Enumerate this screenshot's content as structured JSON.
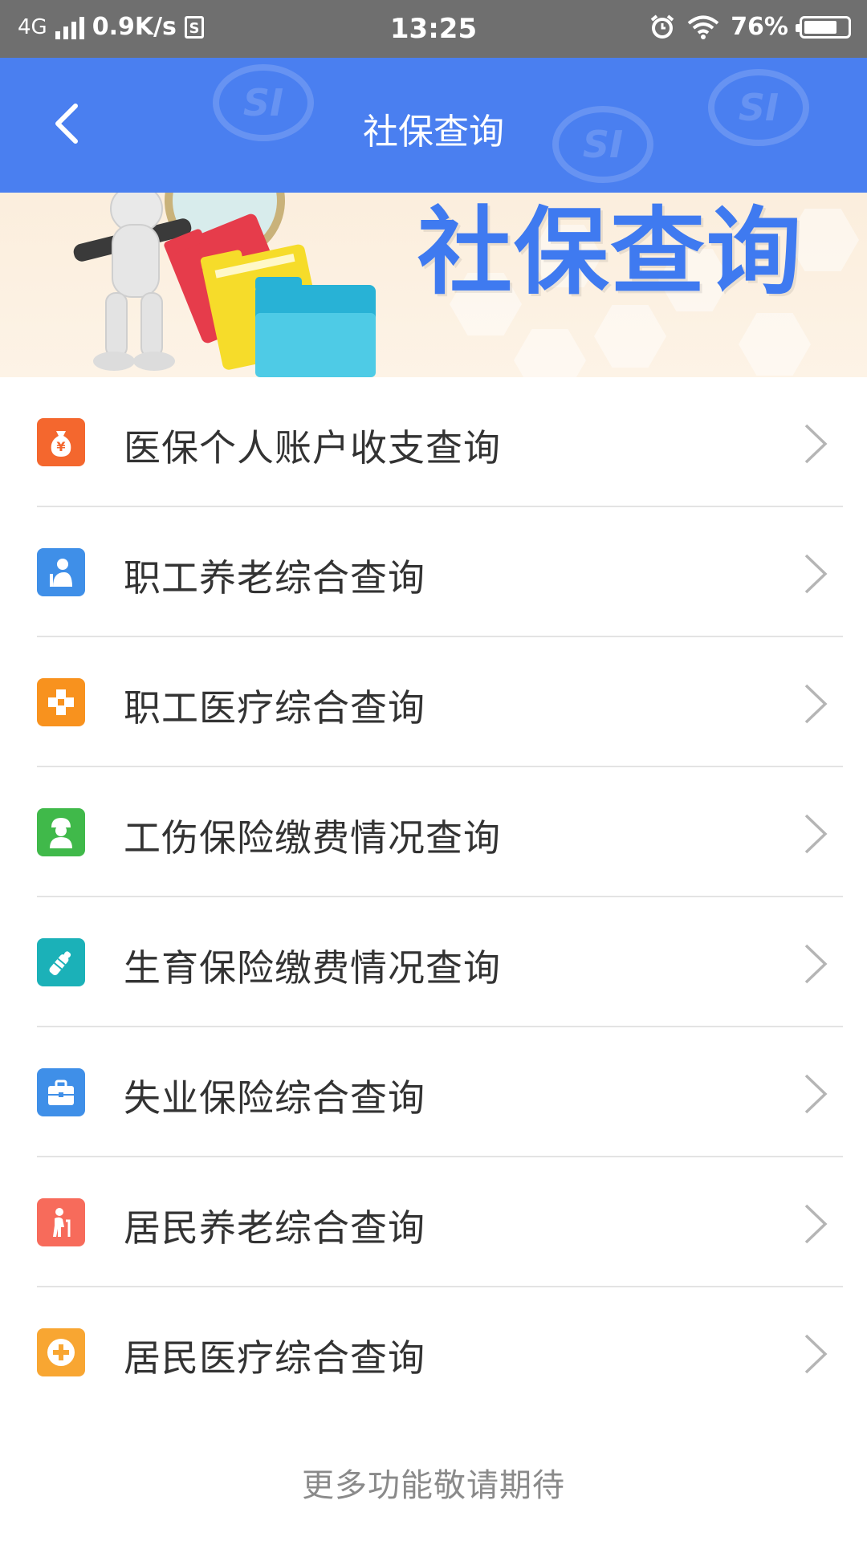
{
  "status_bar": {
    "network": "4G",
    "speed": "0.9K/s",
    "sim_icon_text": "S",
    "time": "13:25",
    "battery_percent": "76%",
    "battery_level": 0.76
  },
  "header": {
    "title": "社保查询",
    "back_icon": "back-arrow-icon",
    "watermark_text": "SI",
    "color": "#4a7ff0"
  },
  "banner": {
    "title": "社保查询"
  },
  "menu": {
    "items": [
      {
        "label": "医保个人账户收支查询",
        "icon": "money-bag-icon",
        "color": "#f4672e"
      },
      {
        "label": "职工养老综合查询",
        "icon": "elderly-worker-icon",
        "color": "#3f8fe8"
      },
      {
        "label": "职工医疗综合查询",
        "icon": "medical-cross-icon",
        "color": "#f8921e"
      },
      {
        "label": "工伤保险缴费情况查询",
        "icon": "helmet-worker-icon",
        "color": "#40b94a"
      },
      {
        "label": "生育保险缴费情况查询",
        "icon": "baby-bottle-icon",
        "color": "#1bb1b8"
      },
      {
        "label": "失业保险综合查询",
        "icon": "briefcase-icon",
        "color": "#3f8fe8"
      },
      {
        "label": "居民养老综合查询",
        "icon": "elder-with-cane-icon",
        "color": "#f76b5b"
      },
      {
        "label": "居民医疗综合查询",
        "icon": "plus-circle-icon",
        "color": "#f8a632"
      }
    ]
  },
  "footer": {
    "note": "更多功能敬请期待"
  }
}
